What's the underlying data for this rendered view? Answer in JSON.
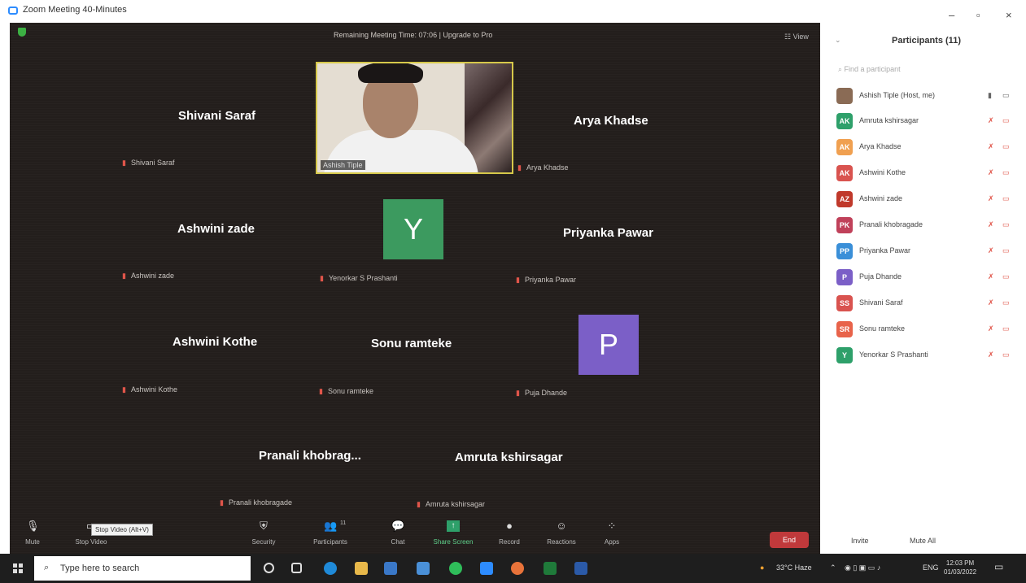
{
  "window": {
    "title": "Zoom Meeting 40-Minutes",
    "minimize": "–",
    "restore": "▫",
    "close": "×"
  },
  "meeting": {
    "timer_text": "Remaining Meeting Time: 07:06 | Upgrade to Pro",
    "view_label": "View",
    "tiles": [
      {
        "name": "Shivani Saraf",
        "label": "Shivani Saraf"
      },
      {
        "name": "Arya Khadse",
        "label": "Arya Khadse"
      },
      {
        "name": "Ashwini zade",
        "label": "Ashwini zade"
      },
      {
        "name": "Priyanka Pawar",
        "label": "Priyanka Pawar"
      },
      {
        "name": "Ashwini Kothe",
        "label": "Ashwini Kothe"
      },
      {
        "name": "Sonu ramteke",
        "label": "Sonu ramteke"
      },
      {
        "name": "Pranali khobrag...",
        "label": "Pranali khobragade"
      },
      {
        "name": "Amruta kshirsagar",
        "label": "Amruta kshirsagar"
      }
    ],
    "video_tile": {
      "name": "Ashish Tiple"
    },
    "avatar_tiles": [
      {
        "letter": "Y",
        "label": "Yenorkar S Prashanti",
        "color": "#3c9a5f"
      },
      {
        "letter": "P",
        "label": "Puja Dhande",
        "color": "#7b5fc7"
      }
    ]
  },
  "toolbar": {
    "mute": "Mute",
    "stop_video": "Stop Video",
    "tooltip": "Stop Video (Alt+V)",
    "security": "Security",
    "participants": "Participants",
    "participants_count": "11",
    "chat": "Chat",
    "share_screen": "Share Screen",
    "record": "Record",
    "reactions": "Reactions",
    "apps": "Apps",
    "end": "End"
  },
  "panel": {
    "title": "Participants (11)",
    "search_placeholder": "Find a participant",
    "participants": [
      {
        "initials": "",
        "name": "Ashish Tiple (Host, me)",
        "color": "#8a6b55"
      },
      {
        "initials": "AK",
        "name": "Amruta kshirsagar",
        "color": "#2ea06a"
      },
      {
        "initials": "AK",
        "name": "Arya Khadse",
        "color": "#f0a050"
      },
      {
        "initials": "AK",
        "name": "Ashwini Kothe",
        "color": "#d9534f"
      },
      {
        "initials": "AZ",
        "name": "Ashwini zade",
        "color": "#c0392b"
      },
      {
        "initials": "PK",
        "name": "Pranali khobragade",
        "color": "#c0415a"
      },
      {
        "initials": "PP",
        "name": "Priyanka Pawar",
        "color": "#3a8fd8"
      },
      {
        "initials": "P",
        "name": "Puja Dhande",
        "color": "#7b5fc7"
      },
      {
        "initials": "SS",
        "name": "Shivani Saraf",
        "color": "#d9534f"
      },
      {
        "initials": "SR",
        "name": "Sonu ramteke",
        "color": "#e8634a"
      },
      {
        "initials": "Y",
        "name": "Yenorkar S Prashanti",
        "color": "#2ea06a"
      }
    ],
    "invite": "Invite",
    "mute_all": "Mute All"
  },
  "taskbar": {
    "search_placeholder": "Type here to search",
    "weather": "33°C Haze",
    "language": "ENG",
    "time": "12:03 PM",
    "date": "01/03/2022"
  }
}
